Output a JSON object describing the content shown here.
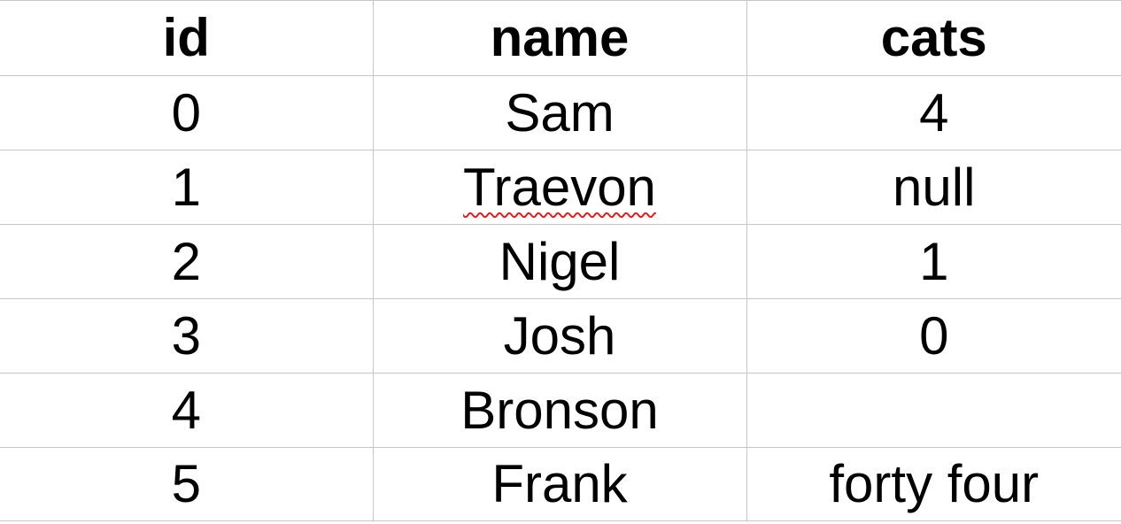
{
  "table": {
    "columns": [
      "id",
      "name",
      "cats"
    ],
    "rows": [
      {
        "id": "0",
        "name": "Sam",
        "cats": "4"
      },
      {
        "id": "1",
        "name": "Traevon",
        "cats": "null"
      },
      {
        "id": "2",
        "name": "Nigel",
        "cats": "1"
      },
      {
        "id": "3",
        "name": "Josh",
        "cats": "0"
      },
      {
        "id": "4",
        "name": "Bronson",
        "cats": ""
      },
      {
        "id": "5",
        "name": "Frank",
        "cats": "forty four"
      }
    ]
  },
  "colors": {
    "gridline": "#c6c6c6",
    "text": "#000000",
    "spellcheck_underline": "#e02020"
  }
}
